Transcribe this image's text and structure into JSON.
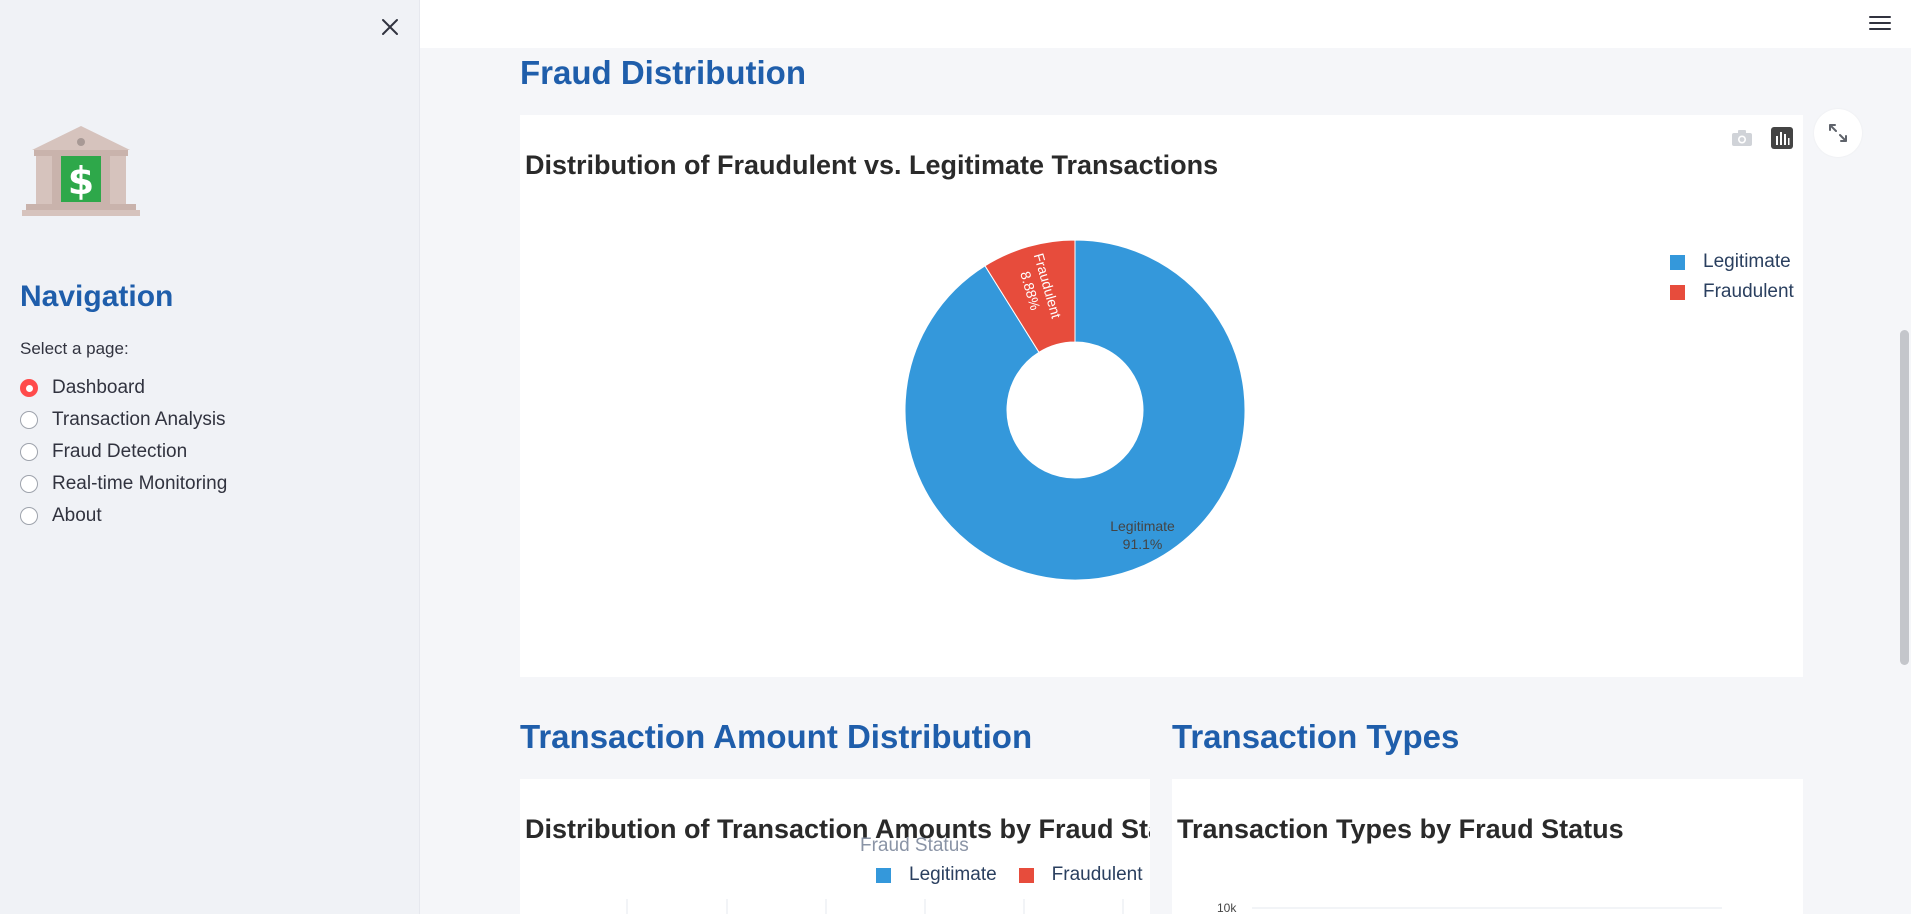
{
  "sidebar": {
    "nav_title": "Navigation",
    "select_label": "Select a page:",
    "pages": [
      {
        "label": "Dashboard",
        "selected": true
      },
      {
        "label": "Transaction Analysis",
        "selected": false
      },
      {
        "label": "Fraud Detection",
        "selected": false
      },
      {
        "label": "Real-time Monitoring",
        "selected": false
      },
      {
        "label": "About",
        "selected": false
      }
    ]
  },
  "main": {
    "fraud_section_title": "Fraud Distribution",
    "amount_section_title": "Transaction Amount Distribution",
    "types_section_title": "Transaction Types",
    "amount_chart_title": "Distribution of Transaction Amounts by Fraud Status",
    "amount_legend_title": "Fraud Status",
    "types_chart_title": "Transaction Types by Fraud Status",
    "types_y_tick": "10k"
  },
  "colors": {
    "accent": "#ff4b4b",
    "heading": "#1f5eab",
    "legitimate": "#3498db",
    "fraudulent": "#e74c3c"
  },
  "chart_data": [
    {
      "type": "pie",
      "hole": 0.4,
      "title": "Distribution of Fraudulent vs. Legitimate Transactions",
      "labels": [
        "Legitimate",
        "Fraudulent"
      ],
      "values": [
        91.1,
        8.88
      ],
      "value_labels": [
        "91.1%",
        "8.88%"
      ],
      "colors": [
        "#3498db",
        "#e74c3c"
      ],
      "legend": "top-right"
    }
  ]
}
